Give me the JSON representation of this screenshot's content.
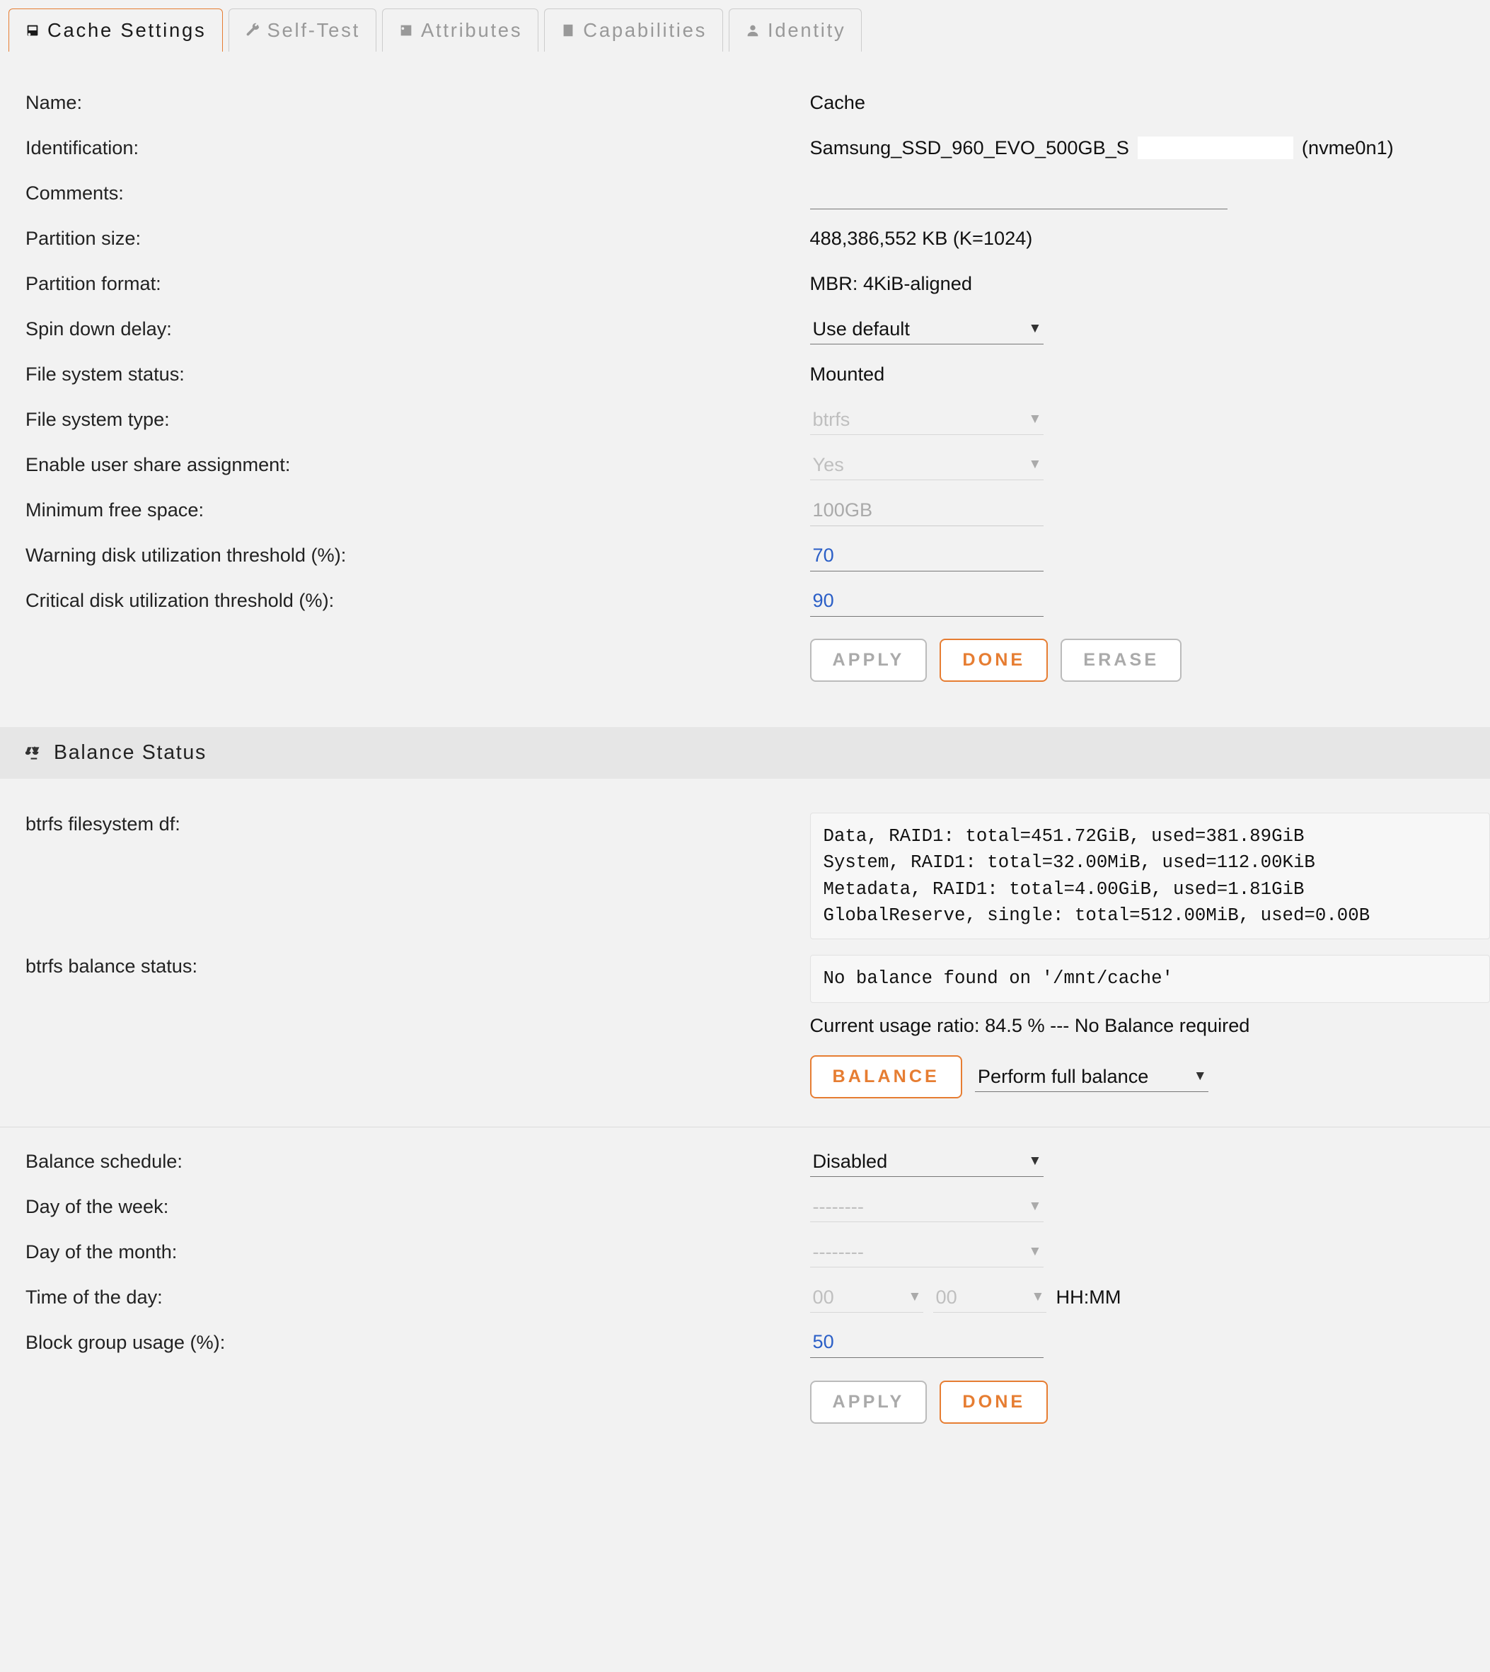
{
  "tabs": [
    {
      "label": "Cache Settings",
      "icon": "disk"
    },
    {
      "label": "Self-Test",
      "icon": "wrench"
    },
    {
      "label": "Attributes",
      "icon": "badge"
    },
    {
      "label": "Capabilities",
      "icon": "building"
    },
    {
      "label": "Identity",
      "icon": "user"
    }
  ],
  "settings": {
    "name_label": "Name:",
    "name_value": "Cache",
    "identification_label": "Identification:",
    "identification_prefix": "Samsung_SSD_960_EVO_500GB_S",
    "identification_suffix": "(nvme0n1)",
    "comments_label": "Comments:",
    "comments_value": "",
    "partition_size_label": "Partition size:",
    "partition_size_value": "488,386,552 KB (K=1024)",
    "partition_format_label": "Partition format:",
    "partition_format_value": "MBR: 4KiB-aligned",
    "spin_down_label": "Spin down delay:",
    "spin_down_value": "Use default",
    "fs_status_label": "File system status:",
    "fs_status_value": "Mounted",
    "fs_type_label": "File system type:",
    "fs_type_value": "btrfs",
    "user_share_label": "Enable user share assignment:",
    "user_share_value": "Yes",
    "min_free_label": "Minimum free space:",
    "min_free_value": "100GB",
    "warn_thresh_label": "Warning disk utilization threshold (%):",
    "warn_thresh_value": "70",
    "crit_thresh_label": "Critical disk utilization threshold (%):",
    "crit_thresh_value": "90",
    "apply_label": "Apply",
    "done_label": "Done",
    "erase_label": "Erase"
  },
  "balance": {
    "section_title": "Balance Status",
    "df_label": "btrfs filesystem df:",
    "df_text": "Data, RAID1: total=451.72GiB, used=381.89GiB\nSystem, RAID1: total=32.00MiB, used=112.00KiB\nMetadata, RAID1: total=4.00GiB, used=1.81GiB\nGlobalReserve, single: total=512.00MiB, used=0.00B",
    "status_label": "btrfs balance status:",
    "status_text": "No balance found on '/mnt/cache'",
    "usage_text": "Current usage ratio: 84.5 % --- No Balance required",
    "balance_btn_label": "Balance",
    "balance_mode": "Perform full balance",
    "schedule_label": "Balance schedule:",
    "schedule_value": "Disabled",
    "dow_label": "Day of the week:",
    "dow_value": "--------",
    "dom_label": "Day of the month:",
    "dom_value": "--------",
    "tod_label": "Time of the day:",
    "tod_hour": "00",
    "tod_min": "00",
    "tod_suffix": "HH:MM",
    "bgu_label": "Block group usage (%):",
    "bgu_value": "50",
    "apply_label": "Apply",
    "done_label": "Done"
  }
}
